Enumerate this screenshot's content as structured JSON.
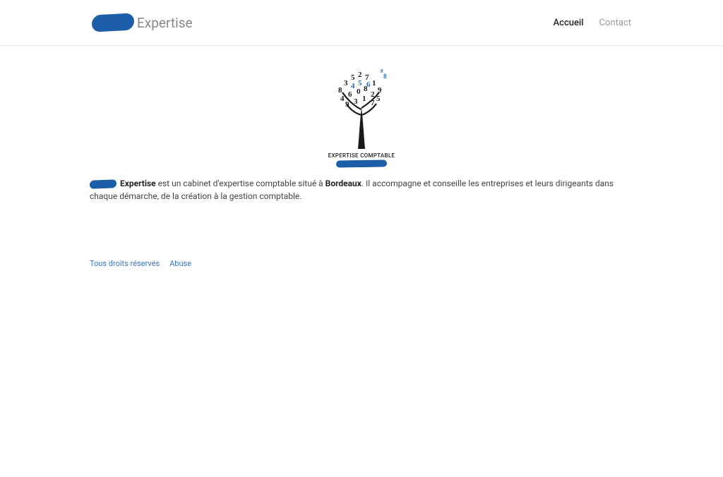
{
  "header": {
    "brand_suffix": "Expertise",
    "nav": [
      {
        "label": "Accueil",
        "active": true
      },
      {
        "label": "Contact",
        "active": false
      }
    ]
  },
  "tree": {
    "caption": "EXPERTISE COMPTABLE"
  },
  "description": {
    "brand_bold": " Expertise",
    "text_part1": " est un cabinet d'expertise comptable situé à ",
    "city_bold": "Bordeaux",
    "text_part2": ". Il accompagne et conseille les entreprises et leurs dirigeants dans chaque démarche, de la création à la gestion comptable."
  },
  "footer": {
    "rights": "Tous droits réservés",
    "abuse": "Abuse"
  }
}
